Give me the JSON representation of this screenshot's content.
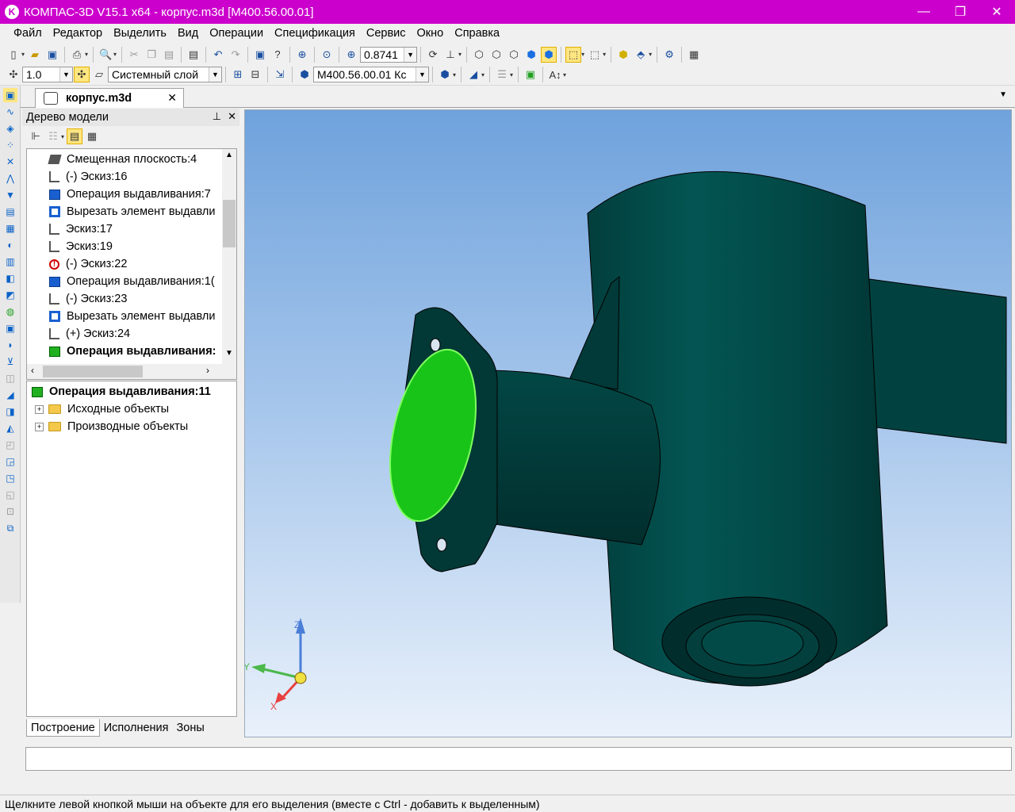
{
  "window": {
    "title": "КОМПАС-3D V15.1 x64 - корпус.m3d [M400.56.00.01]",
    "app_icon_letter": "K",
    "minimize_label": "—",
    "maximize_label": "❐",
    "close_label": "✕"
  },
  "menu": [
    "Файл",
    "Редактор",
    "Выделить",
    "Вид",
    "Операции",
    "Спецификация",
    "Сервис",
    "Окно",
    "Справка"
  ],
  "toolbar1": {
    "zoom_value": "0.8741"
  },
  "toolbar2": {
    "step_value": "1.0",
    "layer_value": "Системный слой",
    "designation_value": "M400.56.00.01 Кс"
  },
  "document_tab": {
    "title": "корпус.m3d",
    "close_label": "✕"
  },
  "model_tree": {
    "panel_title": "Дерево модели",
    "pin_label": "⊥",
    "close_label": "✕",
    "items": [
      {
        "icon": "offset-plane-icon",
        "label": "Смещенная плоскость:4",
        "bold": false
      },
      {
        "icon": "sketch-icon",
        "label": "(-) Эскиз:16",
        "bold": false
      },
      {
        "icon": "extrude-operation-icon",
        "label": "Операция выдавливания:7",
        "bold": false
      },
      {
        "icon": "cut-extrude-icon",
        "label": "Вырезать элемент выдавли",
        "bold": false
      },
      {
        "icon": "sketch-icon",
        "label": "Эскиз:17",
        "bold": false
      },
      {
        "icon": "sketch-icon",
        "label": "Эскиз:19",
        "bold": false
      },
      {
        "icon": "sketch-error-icon",
        "label": "(-) Эскиз:22",
        "bold": false
      },
      {
        "icon": "extrude-operation-icon",
        "label": "Операция выдавливания:1(",
        "bold": false
      },
      {
        "icon": "sketch-icon",
        "label": "(-) Эскиз:23",
        "bold": false
      },
      {
        "icon": "cut-extrude-icon",
        "label": "Вырезать элемент выдавли",
        "bold": false
      },
      {
        "icon": "sketch-icon",
        "label": "(+) Эскиз:24",
        "bold": false
      },
      {
        "icon": "extrude-operation-selected-icon",
        "label": "Операция выдавливания:",
        "bold": true
      }
    ]
  },
  "properties": {
    "title": "Операция выдавливания:11",
    "children": [
      "Исходные объекты",
      "Производные объекты"
    ]
  },
  "bottom_tabs": [
    "Построение",
    "Исполнения",
    "Зоны"
  ],
  "axes": {
    "x": "X",
    "y": "Y",
    "z": "Z"
  },
  "colors": {
    "title_bar": "#cc00cc",
    "model_body": "#024c4a",
    "selected_face": "#18c418",
    "viewport_top": "#6fa2dc",
    "viewport_bottom": "#e9f1fb"
  },
  "status_text": "Щелкните левой кнопкой мыши на объекте для его выделения (вместе с Ctrl - добавить к выделенным)"
}
